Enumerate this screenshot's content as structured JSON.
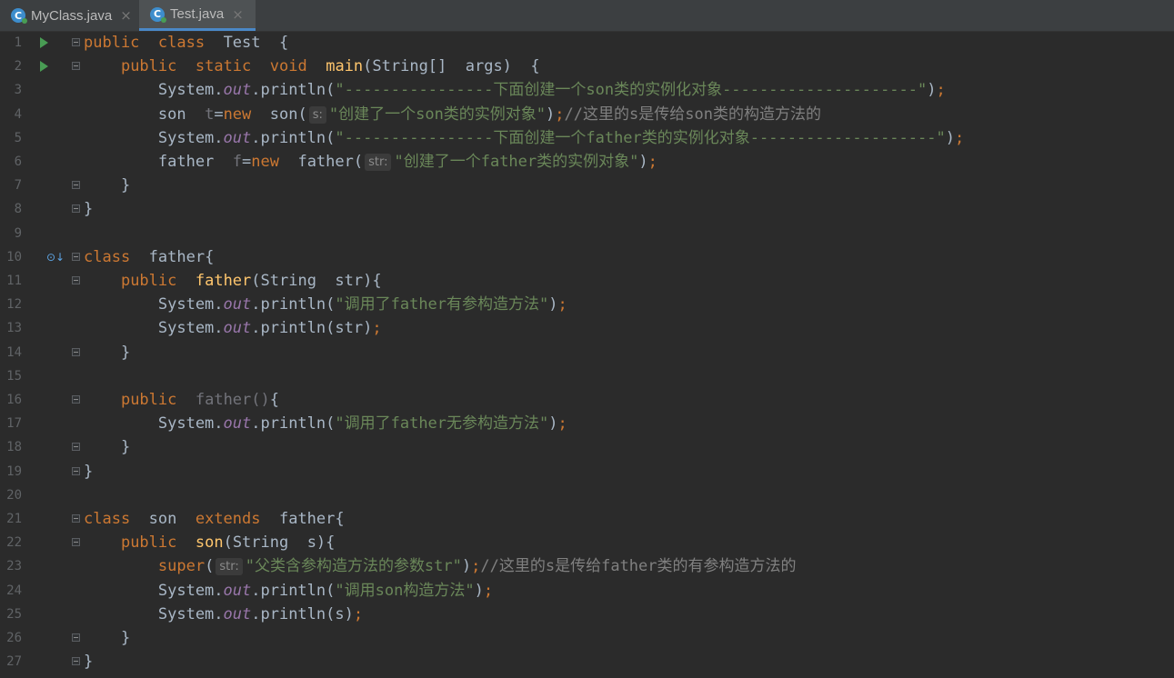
{
  "tabs": [
    {
      "label": "MyClass.java",
      "close": "×",
      "active": false
    },
    {
      "label": "Test.java",
      "close": "×",
      "active": true
    }
  ],
  "tab_icon_letter": "C",
  "colors": {
    "editor_bg": "#2b2b2b",
    "keyword": "#cc7832",
    "method_decl": "#ffc66d",
    "string": "#6a8759",
    "static_field": "#9876aa",
    "comment": "#808080",
    "text": "#a9b7c6",
    "line_number": "#606366",
    "run_gutter": "#499c54"
  },
  "gutter": {
    "run_icon_lines": [
      1,
      2
    ],
    "override_icon_lines": [
      10
    ],
    "override_icon": "overridden-method-icon",
    "run_icon": "run-icon",
    "fold_icon": "fold-icon"
  },
  "lines": [
    {
      "n": "1",
      "fold": true,
      "tokens": [
        [
          "kw",
          "public"
        ],
        [
          "",
          "  "
        ],
        [
          "kw",
          "class"
        ],
        [
          "",
          "  Test  {"
        ]
      ]
    },
    {
      "n": "2",
      "fold": true,
      "tokens": [
        [
          "",
          "    "
        ],
        [
          "kw",
          "public"
        ],
        [
          "",
          "  "
        ],
        [
          "kw",
          "static"
        ],
        [
          "",
          "  "
        ],
        [
          "kw",
          "void"
        ],
        [
          "",
          "  "
        ],
        [
          "fn",
          "main"
        ],
        [
          "",
          "(String[]  args)  {"
        ]
      ]
    },
    {
      "n": "3",
      "fold": false,
      "tokens": [
        [
          "",
          "        System."
        ],
        [
          "fld",
          "out"
        ],
        [
          "",
          ".println("
        ],
        [
          "str",
          "\"----------------下面创建一个son类的实例化对象---------------------\""
        ],
        [
          "",
          ")"
        ],
        [
          "pun",
          ";"
        ]
      ]
    },
    {
      "n": "4",
      "fold": false,
      "tokens": [
        [
          "",
          "        son  "
        ],
        [
          "unused",
          "t"
        ],
        [
          "",
          "="
        ],
        [
          "kw",
          "new"
        ],
        [
          "",
          "  son("
        ],
        [
          "hint",
          "s:"
        ],
        [
          "str",
          "\"创建了一个son类的实例对象\""
        ],
        [
          "",
          ")"
        ],
        [
          "pun",
          ";"
        ],
        [
          "cmt",
          "//这里的s是传给son类的构造方法的"
        ]
      ]
    },
    {
      "n": "5",
      "fold": false,
      "tokens": [
        [
          "",
          "        System."
        ],
        [
          "fld",
          "out"
        ],
        [
          "",
          ".println("
        ],
        [
          "str",
          "\"----------------下面创建一个father类的实例化对象--------------------\""
        ],
        [
          "",
          ")"
        ],
        [
          "pun",
          ";"
        ]
      ]
    },
    {
      "n": "6",
      "fold": false,
      "tokens": [
        [
          "",
          "        father  "
        ],
        [
          "unused",
          "f"
        ],
        [
          "",
          "="
        ],
        [
          "kw",
          "new"
        ],
        [
          "",
          "  father("
        ],
        [
          "hint",
          "str:"
        ],
        [
          "str",
          "\"创建了一个father类的实例对象\""
        ],
        [
          "",
          ")"
        ],
        [
          "pun",
          ";"
        ]
      ]
    },
    {
      "n": "7",
      "fold": true,
      "tokens": [
        [
          "",
          "    }"
        ]
      ]
    },
    {
      "n": "8",
      "fold": true,
      "tokens": [
        [
          "",
          "}"
        ]
      ]
    },
    {
      "n": "9",
      "fold": false,
      "tokens": []
    },
    {
      "n": "10",
      "fold": true,
      "tokens": [
        [
          "kw",
          "class"
        ],
        [
          "",
          "  father{"
        ]
      ]
    },
    {
      "n": "11",
      "fold": true,
      "tokens": [
        [
          "",
          "    "
        ],
        [
          "kw",
          "public"
        ],
        [
          "",
          "  "
        ],
        [
          "fn",
          "father"
        ],
        [
          "",
          "(String  str){"
        ]
      ]
    },
    {
      "n": "12",
      "fold": false,
      "tokens": [
        [
          "",
          "        System."
        ],
        [
          "fld",
          "out"
        ],
        [
          "",
          ".println("
        ],
        [
          "str",
          "\"调用了father有参构造方法\""
        ],
        [
          "",
          ")"
        ],
        [
          "pun",
          ";"
        ]
      ]
    },
    {
      "n": "13",
      "fold": false,
      "tokens": [
        [
          "",
          "        System."
        ],
        [
          "fld",
          "out"
        ],
        [
          "",
          ".println(str)"
        ],
        [
          "pun",
          ";"
        ]
      ]
    },
    {
      "n": "14",
      "fold": true,
      "tokens": [
        [
          "",
          "    }"
        ]
      ]
    },
    {
      "n": "15",
      "fold": false,
      "tokens": []
    },
    {
      "n": "16",
      "fold": true,
      "tokens": [
        [
          "",
          "    "
        ],
        [
          "kw",
          "public"
        ],
        [
          "",
          "  "
        ],
        [
          "unused",
          "father"
        ],
        [
          "unused",
          "()"
        ],
        [
          "",
          "{"
        ]
      ]
    },
    {
      "n": "17",
      "fold": false,
      "tokens": [
        [
          "",
          "        System."
        ],
        [
          "fld",
          "out"
        ],
        [
          "",
          ".println("
        ],
        [
          "str",
          "\"调用了father无参构造方法\""
        ],
        [
          "",
          ")"
        ],
        [
          "pun",
          ";"
        ]
      ]
    },
    {
      "n": "18",
      "fold": true,
      "tokens": [
        [
          "",
          "    }"
        ]
      ]
    },
    {
      "n": "19",
      "fold": true,
      "tokens": [
        [
          "",
          "}"
        ]
      ]
    },
    {
      "n": "20",
      "fold": false,
      "tokens": []
    },
    {
      "n": "21",
      "fold": true,
      "tokens": [
        [
          "kw",
          "class"
        ],
        [
          "",
          "  son  "
        ],
        [
          "kw",
          "extends"
        ],
        [
          "",
          "  father{"
        ]
      ]
    },
    {
      "n": "22",
      "fold": true,
      "tokens": [
        [
          "",
          "    "
        ],
        [
          "kw",
          "public"
        ],
        [
          "",
          "  "
        ],
        [
          "fn",
          "son"
        ],
        [
          "",
          "(String  s){"
        ]
      ]
    },
    {
      "n": "23",
      "fold": false,
      "tokens": [
        [
          "",
          "        "
        ],
        [
          "kw",
          "super"
        ],
        [
          "",
          "("
        ],
        [
          "hint",
          "str:"
        ],
        [
          "str",
          "\"父类含参构造方法的参数str\""
        ],
        [
          "",
          ")"
        ],
        [
          "pun",
          ";"
        ],
        [
          "cmt",
          "//这里的s是传给father类的有参构造方法的"
        ]
      ]
    },
    {
      "n": "24",
      "fold": false,
      "tokens": [
        [
          "",
          "        System."
        ],
        [
          "fld",
          "out"
        ],
        [
          "",
          ".println("
        ],
        [
          "str",
          "\"调用son构造方法\""
        ],
        [
          "",
          ")"
        ],
        [
          "pun",
          ";"
        ]
      ]
    },
    {
      "n": "25",
      "fold": false,
      "tokens": [
        [
          "",
          "        System."
        ],
        [
          "fld",
          "out"
        ],
        [
          "",
          ".println(s)"
        ],
        [
          "pun",
          ";"
        ]
      ]
    },
    {
      "n": "26",
      "fold": true,
      "tokens": [
        [
          "",
          "    }"
        ]
      ]
    },
    {
      "n": "27",
      "fold": true,
      "tokens": [
        [
          "",
          "}"
        ]
      ]
    }
  ]
}
